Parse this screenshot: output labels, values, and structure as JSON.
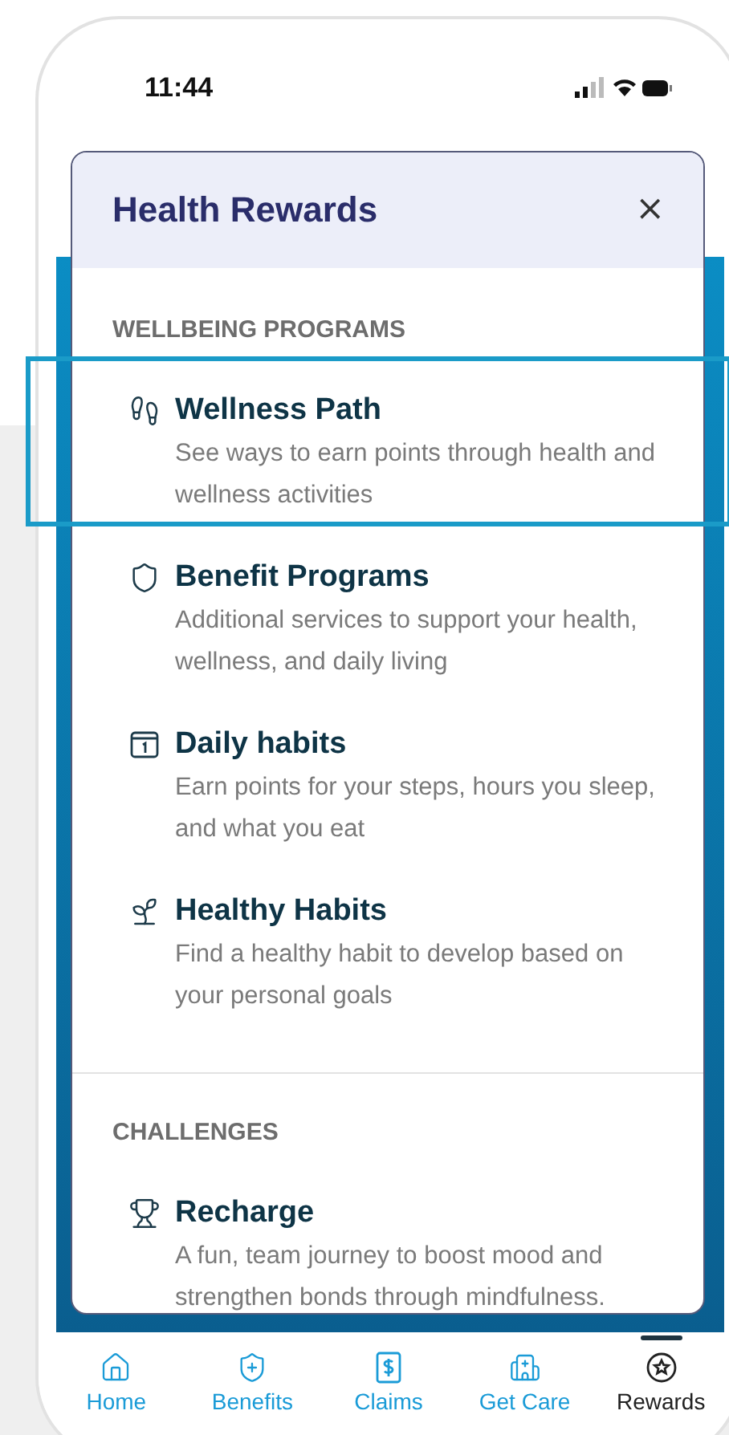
{
  "status_bar": {
    "time": "11:44"
  },
  "modal": {
    "title": "Health Rewards",
    "close": "×",
    "sections": [
      {
        "heading": "WELLBEING PROGRAMS",
        "items": [
          {
            "title": "Wellness Path",
            "description": "See ways to earn points through health and wellness activities",
            "highlighted": true
          },
          {
            "title": "Benefit Programs",
            "description": "Additional services to support your health, wellness, and daily living",
            "highlighted": false
          },
          {
            "title": "Daily habits",
            "description": "Earn points for your steps, hours you sleep, and what you eat",
            "highlighted": false
          },
          {
            "title": "Healthy Habits",
            "description": "Find a healthy habit to develop based on your personal goals",
            "highlighted": false
          }
        ]
      },
      {
        "heading": "CHALLENGES",
        "items": [
          {
            "title": "Recharge",
            "description": "A fun, team journey to boost mood and strengthen bonds through mindfulness.",
            "highlighted": false
          }
        ]
      }
    ]
  },
  "tab_bar": [
    {
      "label": "Home",
      "selected": false
    },
    {
      "label": "Benefits",
      "selected": false
    },
    {
      "label": "Claims",
      "selected": false
    },
    {
      "label": "Get Care",
      "selected": false
    },
    {
      "label": "Rewards",
      "selected": true
    }
  ]
}
